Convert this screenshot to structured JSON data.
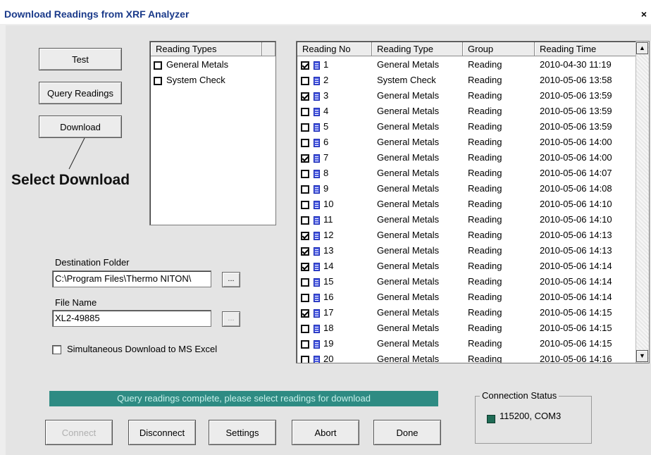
{
  "window": {
    "title": "Download Readings from XRF Analyzer",
    "close_label": "×"
  },
  "left_buttons": {
    "test": "Test",
    "query": "Query Readings",
    "download": "Download"
  },
  "annotation": "Select Download",
  "reading_types": {
    "header": "Reading Types",
    "items": [
      {
        "label": "General Metals",
        "checked": false
      },
      {
        "label": "System Check",
        "checked": false
      }
    ]
  },
  "readings": {
    "columns": [
      "Reading No",
      "Reading Type",
      "Group",
      "Reading Time"
    ],
    "rows": [
      {
        "no": "1",
        "checked": true,
        "type": "General Metals",
        "group": "Reading",
        "time": "2010-04-30 11:19"
      },
      {
        "no": "2",
        "checked": false,
        "type": "System Check",
        "group": "Reading",
        "time": "2010-05-06 13:58"
      },
      {
        "no": "3",
        "checked": true,
        "type": "General Metals",
        "group": "Reading",
        "time": "2010-05-06 13:59"
      },
      {
        "no": "4",
        "checked": false,
        "type": "General Metals",
        "group": "Reading",
        "time": "2010-05-06 13:59"
      },
      {
        "no": "5",
        "checked": false,
        "type": "General Metals",
        "group": "Reading",
        "time": "2010-05-06 13:59"
      },
      {
        "no": "6",
        "checked": false,
        "type": "General Metals",
        "group": "Reading",
        "time": "2010-05-06 14:00"
      },
      {
        "no": "7",
        "checked": true,
        "type": "General Metals",
        "group": "Reading",
        "time": "2010-05-06 14:00"
      },
      {
        "no": "8",
        "checked": false,
        "type": "General Metals",
        "group": "Reading",
        "time": "2010-05-06 14:07"
      },
      {
        "no": "9",
        "checked": false,
        "type": "General Metals",
        "group": "Reading",
        "time": "2010-05-06 14:08"
      },
      {
        "no": "10",
        "checked": false,
        "type": "General Metals",
        "group": "Reading",
        "time": "2010-05-06 14:10"
      },
      {
        "no": "11",
        "checked": false,
        "type": "General Metals",
        "group": "Reading",
        "time": "2010-05-06 14:10"
      },
      {
        "no": "12",
        "checked": true,
        "type": "General Metals",
        "group": "Reading",
        "time": "2010-05-06 14:13"
      },
      {
        "no": "13",
        "checked": true,
        "type": "General Metals",
        "group": "Reading",
        "time": "2010-05-06 14:13"
      },
      {
        "no": "14",
        "checked": true,
        "type": "General Metals",
        "group": "Reading",
        "time": "2010-05-06 14:14"
      },
      {
        "no": "15",
        "checked": false,
        "type": "General Metals",
        "group": "Reading",
        "time": "2010-05-06 14:14"
      },
      {
        "no": "16",
        "checked": false,
        "type": "General Metals",
        "group": "Reading",
        "time": "2010-05-06 14:14"
      },
      {
        "no": "17",
        "checked": true,
        "type": "General Metals",
        "group": "Reading",
        "time": "2010-05-06 14:15"
      },
      {
        "no": "18",
        "checked": false,
        "type": "General Metals",
        "group": "Reading",
        "time": "2010-05-06 14:15"
      },
      {
        "no": "19",
        "checked": false,
        "type": "General Metals",
        "group": "Reading",
        "time": "2010-05-06 14:15"
      },
      {
        "no": "20",
        "checked": false,
        "type": "General Metals",
        "group": "Reading",
        "time": "2010-05-06 14:16"
      }
    ]
  },
  "destination": {
    "label": "Destination Folder",
    "value": "C:\\Program Files\\Thermo NITON\\",
    "browse_label": "..."
  },
  "file_name": {
    "label": "File Name",
    "value": "XL2-49885",
    "browse_label": "..."
  },
  "excel_option": {
    "label": "Simultaneous Download to MS Excel",
    "checked": false
  },
  "status_message": "Query readings complete, please select readings for download",
  "connection": {
    "caption": "Connection Status",
    "value": "115200, COM3"
  },
  "bottom_buttons": {
    "connect": "Connect",
    "disconnect": "Disconnect",
    "settings": "Settings",
    "abort": "Abort",
    "done": "Done"
  },
  "colors": {
    "status_bar": "#2e8b83",
    "title_text": "#1a3a8a",
    "doc_icon": "#4758e0"
  }
}
